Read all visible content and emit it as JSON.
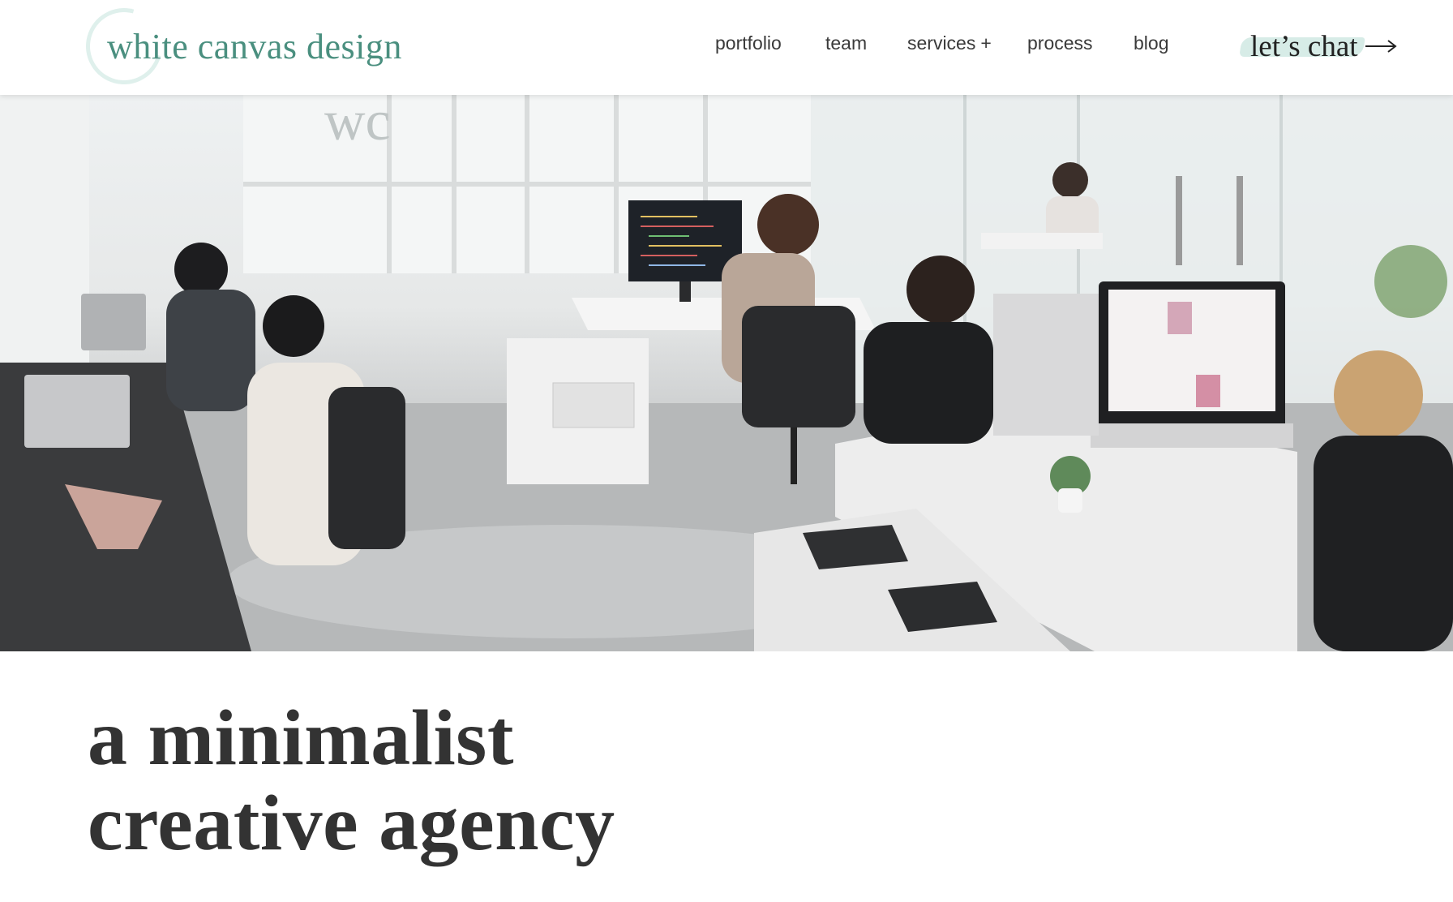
{
  "brand": {
    "name": "white canvas design",
    "accent_color": "#4a8f7f",
    "ring_color": "#dff0ec"
  },
  "nav": {
    "items": [
      {
        "label": "portfolio"
      },
      {
        "label": "team"
      },
      {
        "label": "services",
        "suffix": "+"
      },
      {
        "label": "process"
      },
      {
        "label": "blog"
      }
    ],
    "cta_label": "let’s chat",
    "cta_icon": "arrow-right-icon"
  },
  "hero": {
    "image": "office-team-photo",
    "watermark_text": "wc"
  },
  "headline": {
    "line1": "a minimalist",
    "line2": "creative agency"
  }
}
